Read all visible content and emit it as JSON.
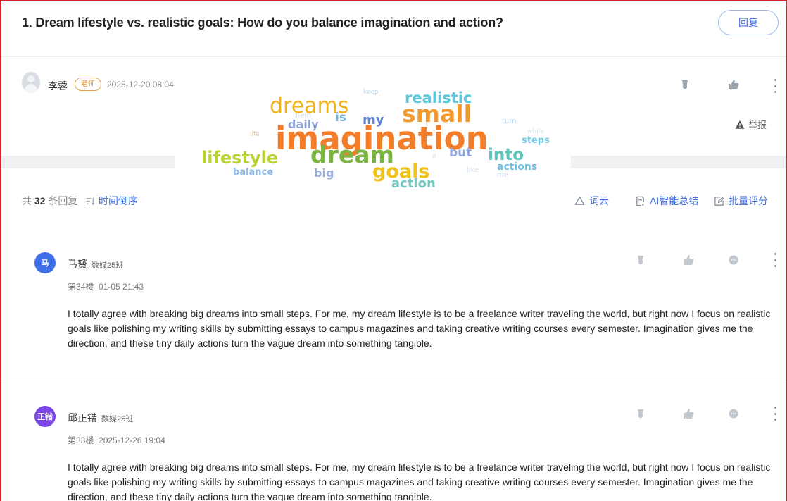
{
  "topic": {
    "title": "1. Dream lifestyle vs. realistic goals: How do you balance imagination and action?",
    "reply_label": "回复"
  },
  "post": {
    "author": "李蓉",
    "badge": "老师",
    "time": "2025-12-20 08:04",
    "report_label": "举报"
  },
  "wordcloud": [
    {
      "word": "keep",
      "color": "#b6d9e8"
    },
    {
      "word": "realistic",
      "color": "#5bc6dc"
    },
    {
      "word": "dreams",
      "color": "#f2b21c"
    },
    {
      "word": "them",
      "color": "#cbe1f0"
    },
    {
      "word": "is",
      "color": "#6db3d9"
    },
    {
      "word": "my",
      "color": "#5b7fd6"
    },
    {
      "word": "small",
      "color": "#f29a2e"
    },
    {
      "word": "turn",
      "color": "#b5d4ec"
    },
    {
      "word": "daily",
      "color": "#8ea4d6"
    },
    {
      "word": "life",
      "color": "#e8c9a0"
    },
    {
      "word": "imagination",
      "color": "#f27d2a"
    },
    {
      "word": "while",
      "color": "#c8dfea"
    },
    {
      "word": "steps",
      "color": "#75c7e8"
    },
    {
      "word": "lifestyle",
      "color": "#b9d232"
    },
    {
      "word": "dream",
      "color": "#7ab441"
    },
    {
      "word": "if",
      "color": "#d7e9c0"
    },
    {
      "word": "but",
      "color": "#8fa6e0"
    },
    {
      "word": "into",
      "color": "#5cc4b8"
    },
    {
      "word": "balance",
      "color": "#8eb8e8"
    },
    {
      "word": "big",
      "color": "#9ab0da"
    },
    {
      "word": "goals",
      "color": "#f0c31a"
    },
    {
      "word": "like",
      "color": "#cfe3f4"
    },
    {
      "word": "actions",
      "color": "#6fbfe2"
    },
    {
      "word": "me",
      "color": "#d2e2f2"
    },
    {
      "word": "action",
      "color": "#77c9c4"
    }
  ],
  "list_header": {
    "total_prefix": "共",
    "total_count": "32",
    "total_suffix": "条回复",
    "sort_label": "时间倒序",
    "wordcloud_label": "词云",
    "ai_summary_label": "AI智能总结",
    "batch_grade_label": "批量评分"
  },
  "replies": [
    {
      "avatar_text": "马",
      "avatar_color": "#3f6fe6",
      "name": "马赟",
      "class": "数媒25班",
      "floor": "第34楼",
      "time": "01-05 21:43",
      "content": "I totally agree with breaking big dreams into small steps. For me, my dream lifestyle is to be a freelance writer traveling the world, but right now I focus on realistic goals like polishing my writing skills by submitting essays to campus magazines and taking creative writing courses every semester. Imagination gives me the direction, and these tiny daily actions turn the vague dream into something tangible."
    },
    {
      "avatar_text": "正锴",
      "avatar_color": "#7b46e6",
      "name": "邱正锴",
      "class": "数媒25班",
      "floor": "第33楼",
      "time": "2025-12-26 19:04",
      "content": "I totally agree with breaking big dreams into small steps. For me, my dream lifestyle is to be a freelance writer traveling the world, but right now I focus on realistic goals like polishing my writing skills by submitting essays to campus magazines and taking creative writing courses every semester. Imagination gives me the direction, and these tiny daily actions turn the vague dream into something tangible."
    }
  ]
}
